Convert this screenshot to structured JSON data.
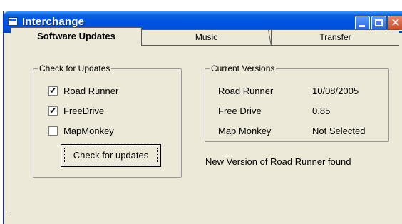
{
  "window": {
    "title": "Interchange"
  },
  "tabs": [
    {
      "label": "Software Updates",
      "active": true
    },
    {
      "label": "Music",
      "active": false
    },
    {
      "label": "Transfer",
      "active": false
    }
  ],
  "check_updates": {
    "legend": "Check for Updates",
    "items": [
      {
        "label": "Road Runner",
        "checked": true
      },
      {
        "label": "FreeDrive",
        "checked": true
      },
      {
        "label": "MapMonkey",
        "checked": false
      }
    ],
    "button_label": "Check for updates"
  },
  "current_versions": {
    "legend": "Current Versions",
    "rows": [
      {
        "name": "Road Runner",
        "version": "10/08/2005"
      },
      {
        "name": "Free Drive",
        "version": "0.85"
      },
      {
        "name": "Map Monkey",
        "version": "Not Selected"
      }
    ]
  },
  "status_text": "New Version of Road Runner found",
  "colors": {
    "titlebar": "#0054e3",
    "face": "#ece9d8"
  }
}
